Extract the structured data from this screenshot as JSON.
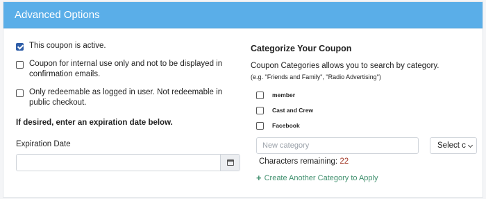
{
  "panel": {
    "title": "Advanced Options"
  },
  "options": [
    {
      "label": "This coupon is active.",
      "checked": true
    },
    {
      "label": "Coupon for internal use only and not to be displayed in confirmation emails.",
      "checked": false
    },
    {
      "label": "Only redeemable as logged in user. Not redeemable in public checkout.",
      "checked": false
    }
  ],
  "expiration": {
    "note": "If desired, enter an expiration date below.",
    "label": "Expiration Date",
    "value": ""
  },
  "categorize": {
    "heading": "Categorize Your Coupon",
    "description": "Coupon Categories allows you to search by category.",
    "example": "(e.g. \"Friends and Family\", \"Radio Advertising\")",
    "items": [
      {
        "label": "member",
        "checked": false
      },
      {
        "label": "Cast and Crew",
        "checked": false
      },
      {
        "label": "Facebook",
        "checked": false
      }
    ],
    "new_category_placeholder": "New category",
    "select_value": "Select c",
    "chars_label": "Characters remaining:",
    "chars_count": "22",
    "add_label": "Create Another Category to Apply"
  },
  "colors": {
    "header": "#5aaee8",
    "checked": "#2f5ea8",
    "count": "#a33b2a",
    "link": "#3f8f6d"
  },
  "icons": [
    "check-icon",
    "calendar-icon",
    "chevron-down-icon",
    "plus-icon"
  ]
}
